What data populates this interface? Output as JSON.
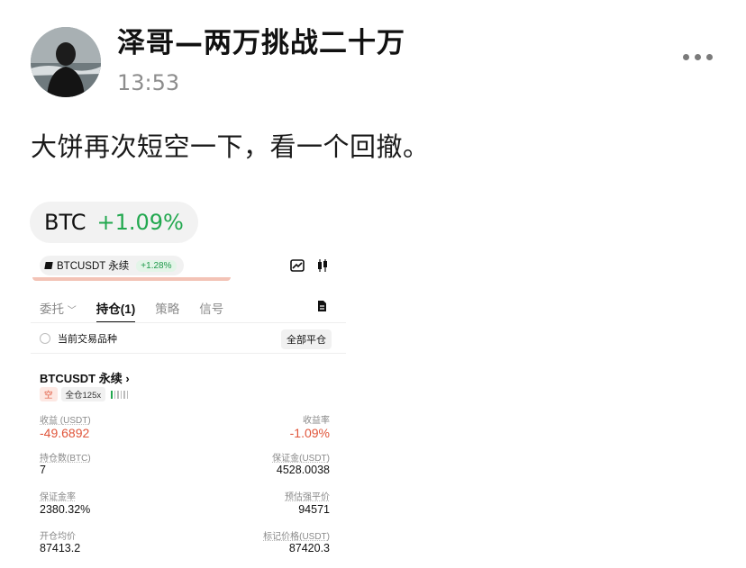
{
  "post": {
    "author": "泽哥—两万挑战二十万",
    "time": "13:53",
    "text": "大饼再次短空一下，看一个回撤。",
    "ticker": {
      "symbol": "BTC",
      "change": "+1.09%"
    }
  },
  "screenshot": {
    "pair": "BTCUSDT 永续",
    "pair_change": "+1.28%",
    "tabs": [
      "委托",
      "持仓(1)",
      "策略",
      "信号"
    ],
    "active_tab": "持仓(1)",
    "filter_label": "当前交易品种",
    "close_all": "全部平仓",
    "position": {
      "symbol": "BTCUSDT 永续",
      "side": "空",
      "margin_mode": "全仓125x",
      "pnl_label": "收益 (USDT)",
      "pnl_value": "-49.6892",
      "roe_label": "收益率",
      "roe_value": "-1.09%",
      "size_label": "持仓数(BTC)",
      "size_value": "7",
      "margin_label": "保证金(USDT)",
      "margin_value": "4528.0038",
      "margin_ratio_label": "保证金率",
      "margin_ratio_value": "2380.32%",
      "liq_label": "预估强平价",
      "liq_value": "94571",
      "entry_label": "开仓均价",
      "entry_value": "87413.2",
      "mark_label": "标记价格(USDT)",
      "mark_value": "87420.3"
    }
  },
  "colors": {
    "up": "#22a84f",
    "down": "#e0553a"
  },
  "icons": [
    "more-icon",
    "chart-icon",
    "candlestick-icon",
    "document-icon",
    "chevron-down-icon",
    "chevron-right-icon"
  ]
}
